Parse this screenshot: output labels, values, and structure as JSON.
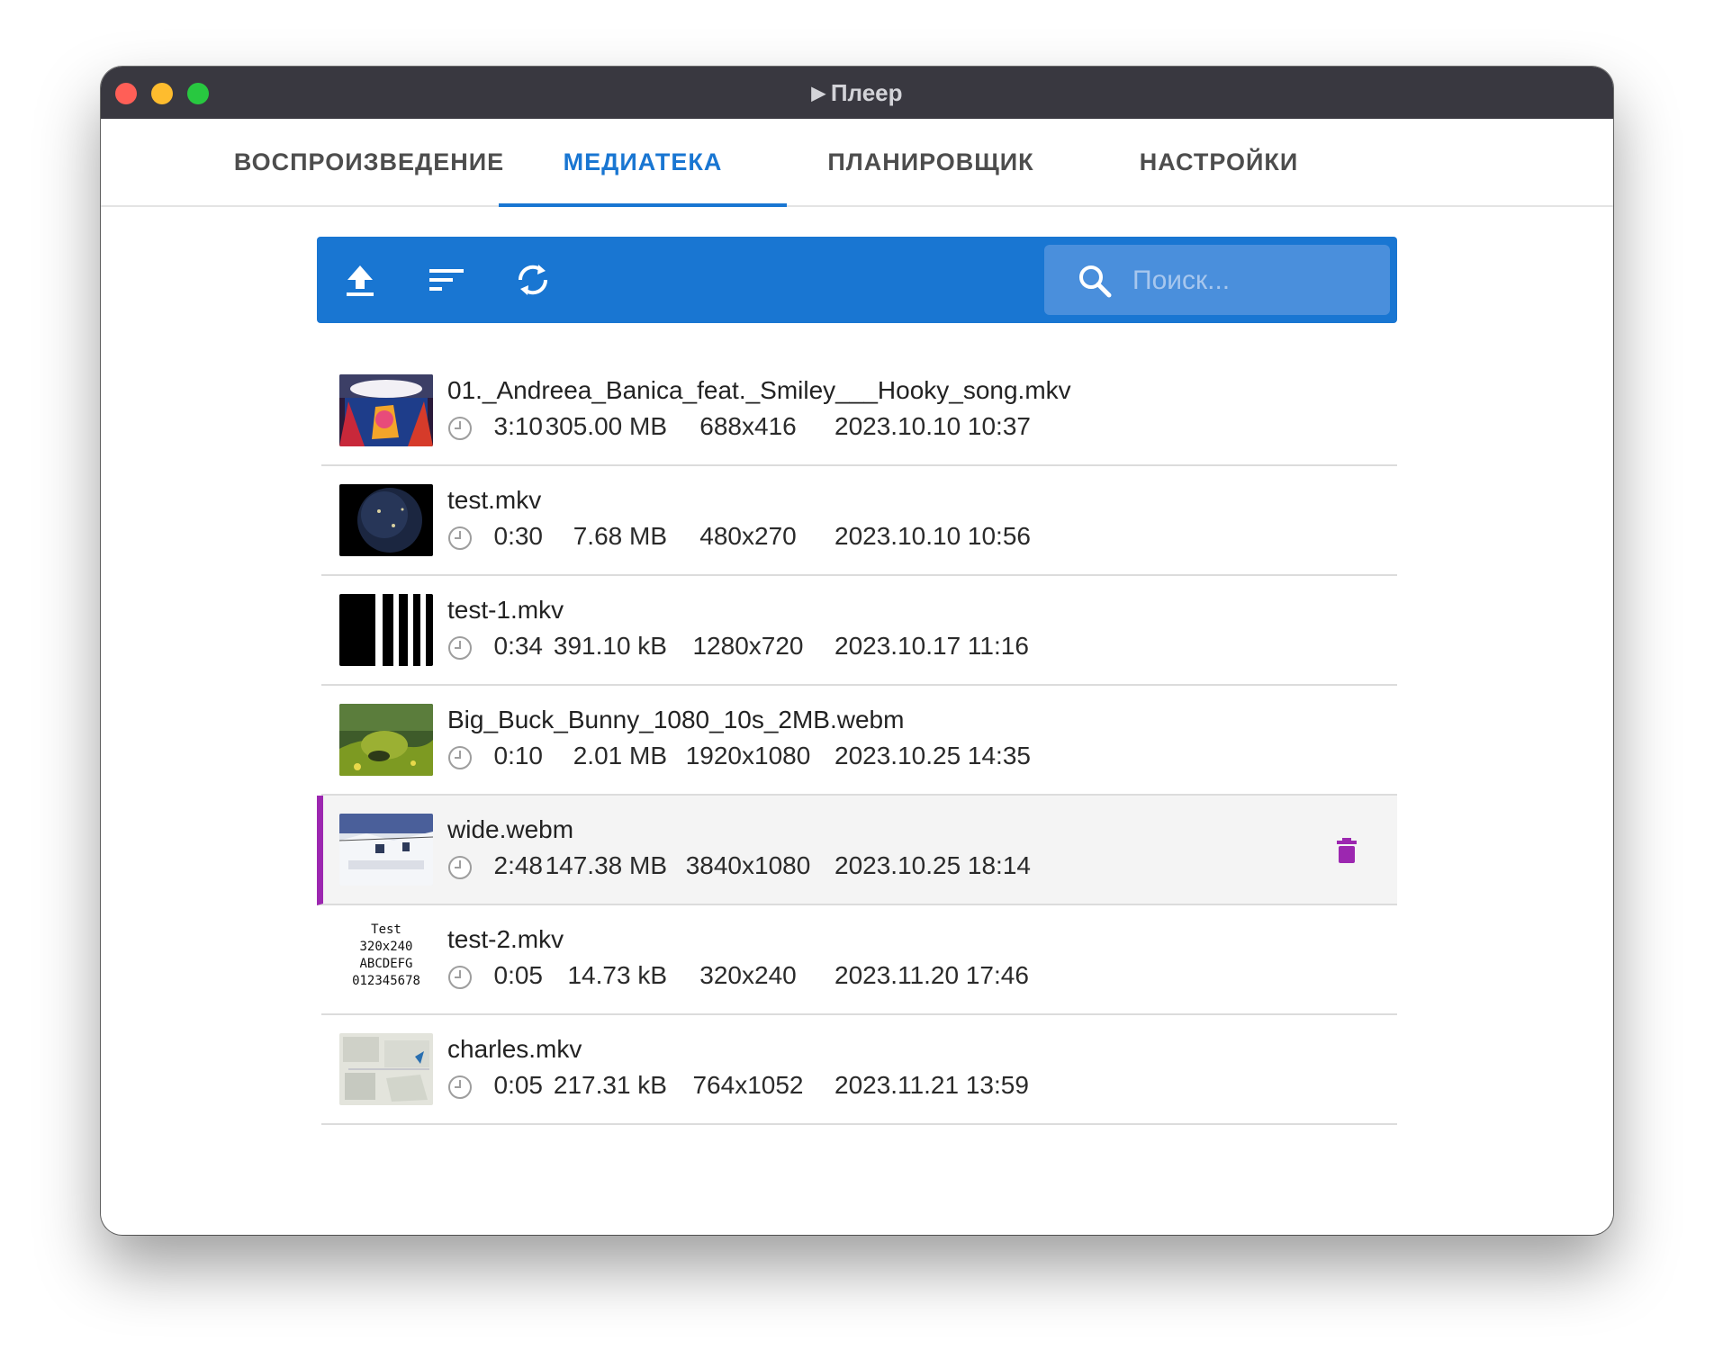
{
  "window": {
    "title": "Плеер"
  },
  "tabs": [
    {
      "label": "ВОСПРОИЗВЕДЕНИЕ"
    },
    {
      "label": "МЕДИАТЕКА"
    },
    {
      "label": "ПЛАНИРОВЩИК"
    },
    {
      "label": "НАСТРОЙКИ"
    }
  ],
  "active_tab": "МЕДИАТЕКА",
  "toolbar": {
    "buttons": [
      "upload-icon",
      "sort-icon",
      "refresh-icon"
    ],
    "search_placeholder": "Поиск..."
  },
  "files": [
    {
      "name": "01._Andreea_Banica_feat._Smiley___Hooky_song.mkv",
      "duration": "3:10",
      "size": "305.00 MB",
      "resolution": "688x416",
      "date": "2023.10.10 10:37"
    },
    {
      "name": "test.mkv",
      "duration": "0:30",
      "size": "7.68 MB",
      "resolution": "480x270",
      "date": "2023.10.10 10:56"
    },
    {
      "name": "test-1.mkv",
      "duration": "0:34",
      "size": "391.10 kB",
      "resolution": "1280x720",
      "date": "2023.10.17 11:16"
    },
    {
      "name": "Big_Buck_Bunny_1080_10s_2MB.webm",
      "duration": "0:10",
      "size": "2.01 MB",
      "resolution": "1920x1080",
      "date": "2023.10.25 14:35"
    },
    {
      "name": "wide.webm",
      "duration": "2:48",
      "size": "147.38 MB",
      "resolution": "3840x1080",
      "date": "2023.10.25 18:14",
      "selected": true
    },
    {
      "name": "test-2.mkv",
      "duration": "0:05",
      "size": "14.73 kB",
      "resolution": "320x240",
      "date": "2023.11.20 17:46",
      "thumb_text": [
        "Test",
        "320x240",
        "ABCDEFG",
        "012345678"
      ]
    },
    {
      "name": "charles.mkv",
      "duration": "0:05",
      "size": "217.31 kB",
      "resolution": "764x1052",
      "date": "2023.11.21 13:59"
    }
  ],
  "colors": {
    "accent": "#1976d2",
    "selection": "#9c27b0",
    "titlebar": "#393840"
  }
}
